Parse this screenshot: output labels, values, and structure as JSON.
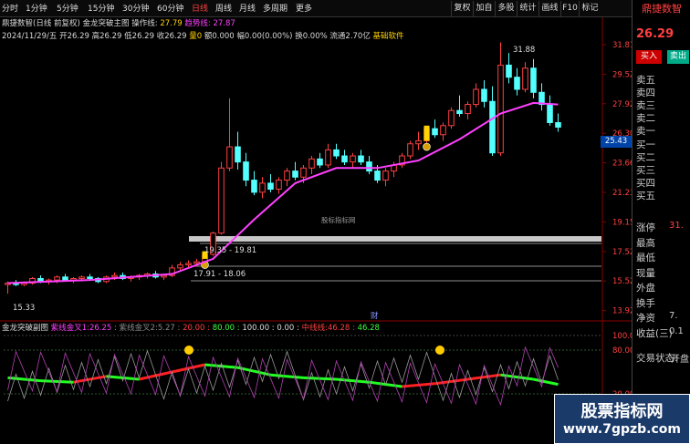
{
  "toolbar": {
    "items": [
      "分时",
      "1分钟",
      "5分钟",
      "15分钟",
      "30分钟",
      "60分钟",
      "日线",
      "周线",
      "月线",
      "多周期",
      "更多"
    ],
    "active": 6,
    "right": [
      "复权",
      "加自",
      "多股",
      "统计",
      "画线",
      "F10",
      "标记"
    ]
  },
  "info1": {
    "name": "鼎捷数智(日线 前复权)",
    "indicator": "金龙突破主图",
    "line1_label": "操作线:",
    "line1_value": "27.79",
    "line2_label": "趋势线:",
    "line2_value": "27.87"
  },
  "info2": {
    "date": "2024/11/29/五",
    "open": "开26.29",
    "high": "高26.29",
    "low": "低26.29",
    "close": "收26.29",
    "vol": "量0",
    "amount": "额0.000",
    "change": "幅0.00(0.00%)",
    "turnover": "换0.00%",
    "float": "流通2.70亿",
    "sector": "基础软件"
  },
  "price_labels": {
    "max": "31.88",
    "current": "25.43",
    "min": "15.33",
    "band1": "19.35 - 19.81",
    "band2": "17.91 - 18.06",
    "center": "股标指标网",
    "marker": "财"
  },
  "axis": {
    "ticks": [
      "31.81",
      "29.52",
      "27.92",
      "26.30",
      "23.66",
      "21.23",
      "19.15",
      "17.52",
      "15.52",
      "13.92"
    ]
  },
  "indicator": {
    "name": "金龙突破副图",
    "items": [
      {
        "label": "紫线金叉1:",
        "value": "26.25"
      },
      {
        "label": "紫线金叉2:",
        "value": "5.27"
      },
      {
        "label": "",
        "value": "20.00"
      },
      {
        "label": "",
        "value": "80.00"
      },
      {
        "label": "",
        "value": "100.00"
      },
      {
        "label": "",
        "value": "0.00"
      },
      {
        "label": "中线线:",
        "value": "46.28"
      },
      {
        "label": "",
        "value": "46.28"
      }
    ],
    "ticks": [
      "100.00",
      "80.00",
      "20.00"
    ]
  },
  "right_panel": {
    "title": "鼎捷数智",
    "price": "26.29",
    "buy": "买入",
    "sell": "卖出",
    "sells": [
      "卖五",
      "卖四",
      "卖三",
      "卖二",
      "卖一"
    ],
    "buys": [
      "买一",
      "买二",
      "买三",
      "买四",
      "买五"
    ],
    "stats": [
      {
        "label": "涨停",
        "value": "31."
      },
      {
        "label": "最高",
        "value": ""
      },
      {
        "label": "最低",
        "value": ""
      },
      {
        "label": "现量",
        "value": ""
      },
      {
        "label": "外盘",
        "value": ""
      },
      {
        "label": "换手",
        "value": ""
      },
      {
        "label": "净资",
        "value": "7."
      },
      {
        "label": "收益(三)",
        "value": "0.1"
      },
      {
        "label": "交易状态:",
        "value": "开盘"
      }
    ]
  },
  "watermark": {
    "line1": "股票指标网",
    "line2": "www.7gpzb.com"
  },
  "chart_data": {
    "type": "candlestick",
    "candles": [
      [
        15.9,
        16.1,
        15.3,
        16.0
      ],
      [
        16.0,
        16.2,
        15.8,
        15.9
      ],
      [
        15.9,
        16.1,
        15.8,
        16.0
      ],
      [
        16.0,
        16.4,
        15.9,
        16.3
      ],
      [
        16.3,
        16.5,
        16.0,
        16.1
      ],
      [
        16.1,
        16.3,
        15.9,
        16.2
      ],
      [
        16.2,
        16.5,
        16.0,
        16.4
      ],
      [
        16.4,
        16.6,
        16.1,
        16.2
      ],
      [
        16.2,
        16.4,
        16.0,
        16.3
      ],
      [
        16.3,
        16.5,
        16.1,
        16.4
      ],
      [
        16.4,
        16.6,
        16.2,
        16.3
      ],
      [
        16.3,
        16.4,
        16.0,
        16.1
      ],
      [
        16.1,
        16.5,
        16.0,
        16.4
      ],
      [
        16.4,
        16.7,
        16.2,
        16.5
      ],
      [
        16.5,
        16.7,
        16.2,
        16.3
      ],
      [
        16.3,
        16.5,
        16.1,
        16.4
      ],
      [
        16.4,
        16.6,
        16.2,
        16.5
      ],
      [
        16.5,
        16.7,
        16.3,
        16.6
      ],
      [
        16.6,
        16.8,
        16.3,
        16.4
      ],
      [
        16.4,
        16.6,
        16.2,
        16.5
      ],
      [
        16.5,
        17.2,
        16.4,
        17.0
      ],
      [
        17.0,
        17.4,
        16.8,
        17.2
      ],
      [
        17.2,
        17.5,
        17.0,
        17.3
      ],
      [
        17.3,
        17.6,
        17.1,
        17.4
      ],
      [
        17.4,
        18.1,
        17.3,
        17.9
      ],
      [
        17.9,
        19.4,
        17.8,
        19.3
      ],
      [
        19.3,
        24.0,
        19.2,
        23.6
      ],
      [
        23.6,
        28.2,
        23.4,
        25.0
      ],
      [
        25.0,
        26.0,
        23.5,
        24.0
      ],
      [
        24.0,
        24.6,
        22.4,
        22.8
      ],
      [
        22.8,
        23.4,
        21.8,
        22.0
      ],
      [
        22.0,
        23.0,
        21.6,
        22.6
      ],
      [
        22.6,
        23.2,
        22.0,
        22.2
      ],
      [
        22.2,
        23.0,
        21.9,
        22.8
      ],
      [
        22.8,
        23.6,
        22.4,
        23.4
      ],
      [
        23.4,
        24.0,
        22.8,
        23.0
      ],
      [
        23.0,
        23.8,
        22.6,
        23.6
      ],
      [
        23.6,
        24.4,
        23.2,
        24.2
      ],
      [
        24.2,
        24.6,
        23.6,
        23.8
      ],
      [
        23.8,
        25.2,
        23.6,
        24.8
      ],
      [
        24.8,
        25.2,
        24.2,
        24.4
      ],
      [
        24.4,
        24.8,
        23.8,
        24.0
      ],
      [
        24.0,
        24.6,
        23.6,
        24.4
      ],
      [
        24.4,
        24.8,
        23.8,
        24.0
      ],
      [
        24.0,
        24.4,
        23.2,
        23.4
      ],
      [
        23.4,
        23.8,
        22.6,
        22.8
      ],
      [
        22.8,
        23.6,
        22.4,
        23.4
      ],
      [
        23.4,
        24.0,
        23.0,
        23.8
      ],
      [
        23.8,
        24.6,
        23.6,
        24.4
      ],
      [
        24.4,
        25.4,
        24.2,
        25.2
      ],
      [
        25.2,
        26.0,
        24.8,
        25.4
      ],
      [
        25.4,
        26.4,
        25.2,
        26.2
      ],
      [
        26.2,
        26.8,
        25.6,
        25.8
      ],
      [
        25.8,
        26.6,
        25.4,
        26.4
      ],
      [
        26.4,
        27.6,
        26.2,
        27.4
      ],
      [
        27.4,
        28.4,
        27.0,
        27.2
      ],
      [
        27.2,
        28.0,
        26.8,
        27.8
      ],
      [
        27.8,
        29.2,
        27.6,
        28.8
      ],
      [
        28.8,
        29.4,
        27.6,
        28.0
      ],
      [
        28.0,
        29.0,
        24.4,
        24.6
      ],
      [
        24.6,
        31.9,
        24.4,
        30.4
      ],
      [
        30.4,
        31.2,
        29.2,
        29.6
      ],
      [
        29.6,
        30.2,
        28.4,
        28.8
      ],
      [
        28.8,
        30.6,
        28.6,
        30.2
      ],
      [
        30.2,
        30.8,
        28.2,
        28.6
      ],
      [
        28.6,
        29.2,
        27.4,
        27.8
      ],
      [
        27.8,
        28.4,
        26.4,
        26.6
      ],
      [
        26.6,
        27.2,
        26.0,
        26.3
      ]
    ],
    "ylim": [
      13.92,
      31.81
    ],
    "ma_points": [
      [
        0,
        16.0
      ],
      [
        10,
        16.2
      ],
      [
        20,
        16.6
      ],
      [
        25,
        17.6
      ],
      [
        30,
        20.2
      ],
      [
        35,
        22.6
      ],
      [
        40,
        23.6
      ],
      [
        45,
        23.6
      ],
      [
        50,
        24.1
      ],
      [
        55,
        25.5
      ],
      [
        60,
        27.2
      ],
      [
        64,
        27.9
      ],
      [
        67,
        27.8
      ]
    ],
    "ind_line_points": [
      [
        0,
        42
      ],
      [
        4,
        38
      ],
      [
        8,
        36
      ],
      [
        12,
        44
      ],
      [
        16,
        40
      ],
      [
        20,
        50
      ],
      [
        24,
        60
      ],
      [
        28,
        56
      ],
      [
        32,
        46
      ],
      [
        36,
        42
      ],
      [
        40,
        40
      ],
      [
        44,
        36
      ],
      [
        48,
        30
      ],
      [
        52,
        34
      ],
      [
        56,
        40
      ],
      [
        60,
        46
      ],
      [
        64,
        40
      ],
      [
        67,
        33
      ]
    ],
    "ind_ylim": [
      0,
      100
    ]
  }
}
